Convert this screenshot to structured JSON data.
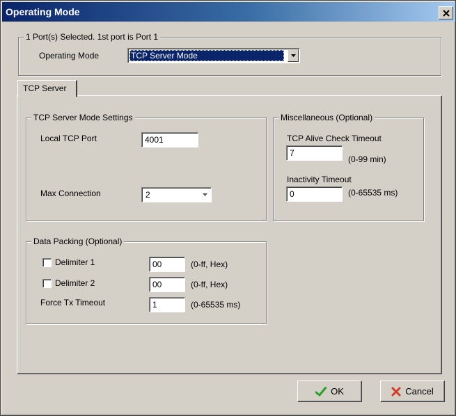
{
  "window": {
    "title": "Operating Mode"
  },
  "port_group": {
    "legend": "1 Port(s) Selected. 1st port is Port 1",
    "mode_label": "Operating Mode",
    "mode_value": "TCP Server Mode"
  },
  "tabs": [
    {
      "label": "TCP Server"
    }
  ],
  "server_settings": {
    "legend": "TCP Server Mode Settings",
    "local_port_label": "Local TCP Port",
    "local_port_value": "4001",
    "max_conn_label": "Max Connection",
    "max_conn_value": "2"
  },
  "misc": {
    "legend": "Miscellaneous (Optional)",
    "alive_label": "TCP Alive Check Timeout",
    "alive_value": "7",
    "alive_range": "(0-99 min)",
    "inactivity_label": "Inactivity Timeout",
    "inactivity_value": "0",
    "inactivity_range": "(0-65535 ms)"
  },
  "packing": {
    "legend": "Data Packing (Optional)",
    "delim1_label": "Delimiter 1",
    "delim1_value": "00",
    "delim1_range": "(0-ff, Hex)",
    "delim2_label": "Delimiter 2",
    "delim2_value": "00",
    "delim2_range": "(0-ff, Hex)",
    "force_label": "Force Tx Timeout",
    "force_value": "1",
    "force_range": "(0-65535 ms)"
  },
  "buttons": {
    "ok": "OK",
    "cancel": "Cancel"
  },
  "colors": {
    "ok_check": "#2a9d2a",
    "cancel_x": "#d23a2a",
    "title_bar": "#0a246a"
  }
}
